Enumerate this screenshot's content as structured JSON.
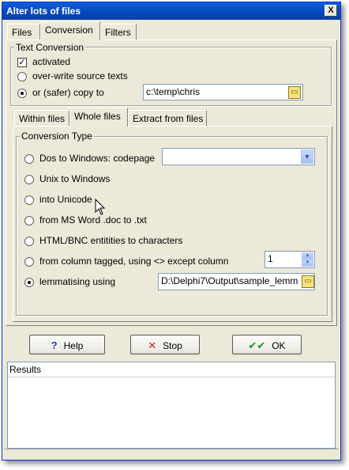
{
  "window": {
    "title": "Alter lots of files",
    "close_glyph": "X"
  },
  "top_tabs": [
    {
      "label": "Files",
      "active": false
    },
    {
      "label": "Conversion",
      "active": true
    },
    {
      "label": "Filters",
      "active": false
    }
  ],
  "text_conversion": {
    "legend": "Text Conversion",
    "activated_label": "activated",
    "activated_checked": true,
    "overwrite_label": "over-write source texts",
    "copy_label": "or (safer) copy to",
    "copy_path": "c:\\temp\\chris",
    "selected_option": "copy"
  },
  "sub_tabs": [
    {
      "label": "Within files",
      "active": false
    },
    {
      "label": "Whole files",
      "active": true
    },
    {
      "label": "Extract from files",
      "active": false
    }
  ],
  "conversion_type": {
    "legend": "Conversion Type",
    "options": [
      {
        "label": "Dos to Windows: codepage",
        "checked": false
      },
      {
        "label": "Unix to Windows",
        "checked": false
      },
      {
        "label": "into Unicode",
        "checked": false
      },
      {
        "label": "from MS Word .doc to .txt",
        "checked": false
      },
      {
        "label": "HTML/BNC entitities to characters",
        "checked": false
      },
      {
        "label": "from column tagged, using <> except column",
        "checked": false
      },
      {
        "label": "lemmatising using",
        "checked": true
      }
    ],
    "codepage_value": "",
    "column_value": "1",
    "lemma_path": "D:\\Delphi7\\Output\\sample_lemm"
  },
  "buttons": {
    "help_label": "Help",
    "help_icon": "?",
    "stop_label": "Stop",
    "stop_icon": "✕",
    "ok_label": "OK",
    "ok_icon": "✔✔"
  },
  "results": {
    "header": "Results"
  },
  "colors": {
    "titlebar": "#0a5fdc",
    "help_icon": "#1a3fd0",
    "stop_icon": "#d01818",
    "ok_icon": "#1a9a1a"
  }
}
